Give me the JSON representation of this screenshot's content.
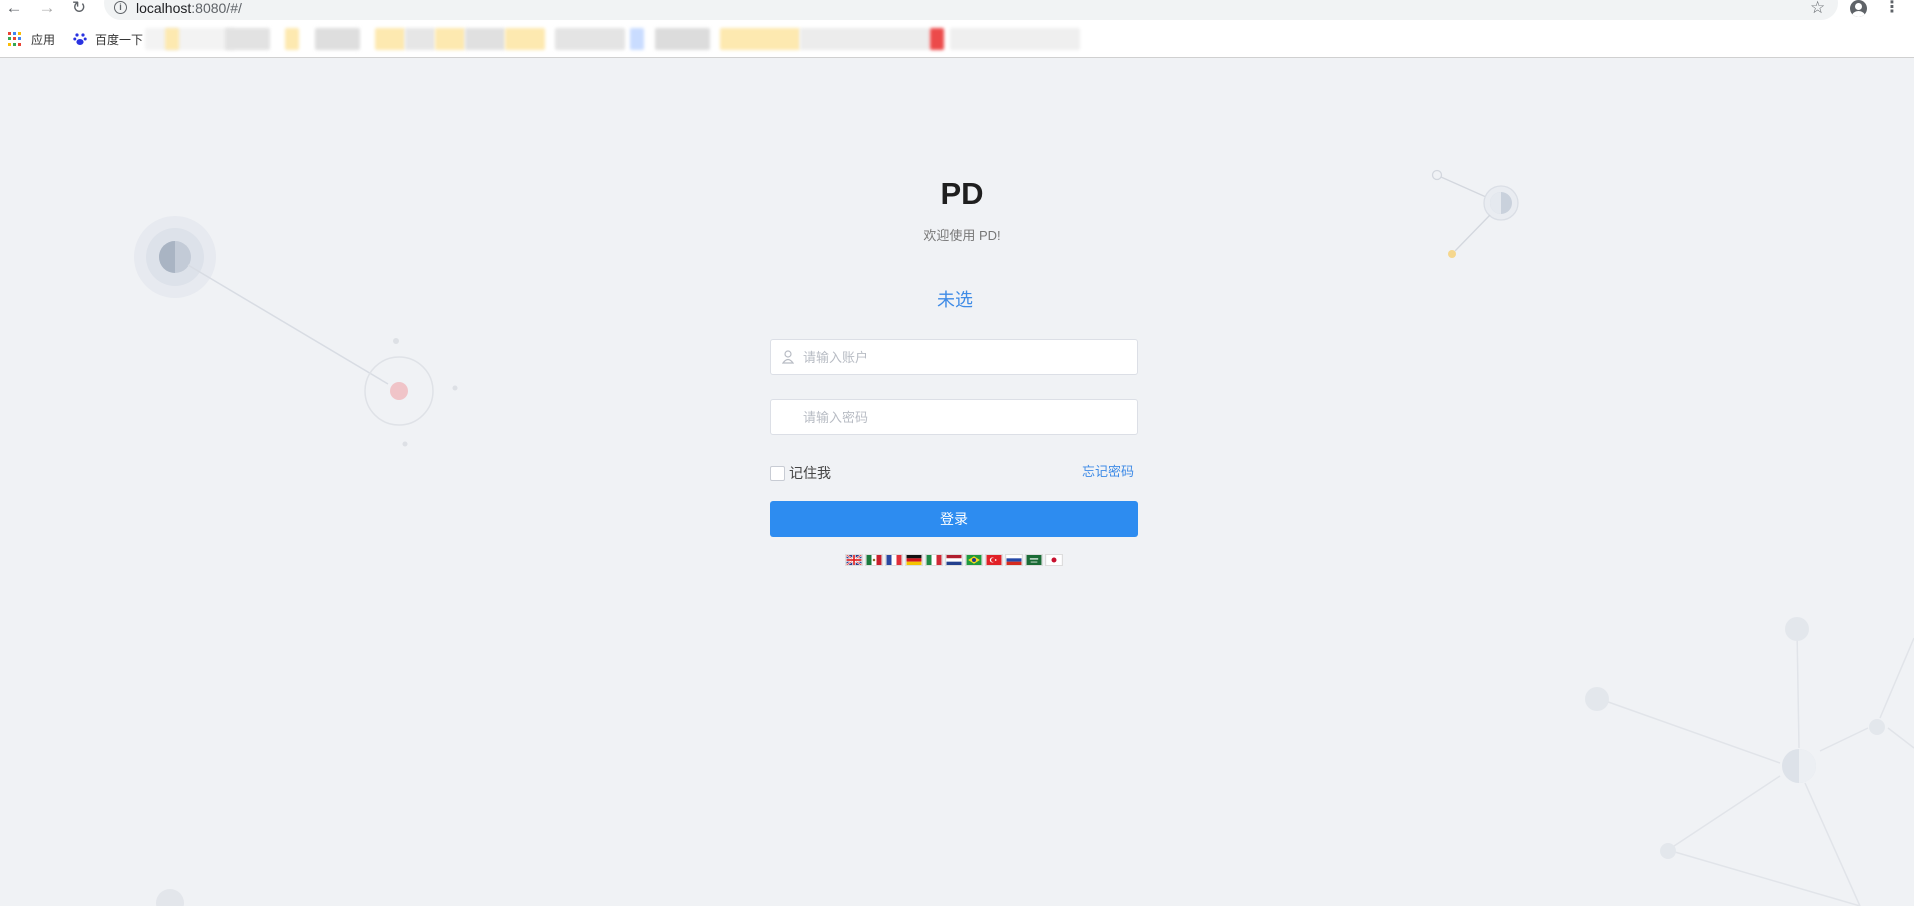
{
  "browser": {
    "url_host": "localhost",
    "url_rest": ":8080/#/",
    "bookmarks": [
      {
        "label": "应用",
        "icon": "apps-grid-icon"
      },
      {
        "label": "百度一下",
        "icon": "baidu-paw-icon"
      }
    ]
  },
  "login": {
    "title": "PD",
    "subtitle": "欢迎使用 PD!",
    "tenant_label": "未选",
    "account_placeholder": "请输入账户",
    "password_placeholder": "请输入密码",
    "remember_label": "记住我",
    "forgot_label": "忘记密码",
    "submit_label": "登录"
  },
  "languages": [
    {
      "name": "english-flag-icon"
    },
    {
      "name": "mexico-flag-icon"
    },
    {
      "name": "france-flag-icon"
    },
    {
      "name": "germany-flag-icon"
    },
    {
      "name": "italy-flag-icon"
    },
    {
      "name": "netherlands-flag-icon"
    },
    {
      "name": "brazil-flag-icon"
    },
    {
      "name": "turkey-flag-icon"
    },
    {
      "name": "russia-flag-icon"
    },
    {
      "name": "saudi-arabia-flag-icon"
    },
    {
      "name": "japan-flag-icon"
    }
  ],
  "colors": {
    "accent": "#2d8cf0",
    "link": "#3e8be6",
    "background": "#f0f2f5"
  }
}
